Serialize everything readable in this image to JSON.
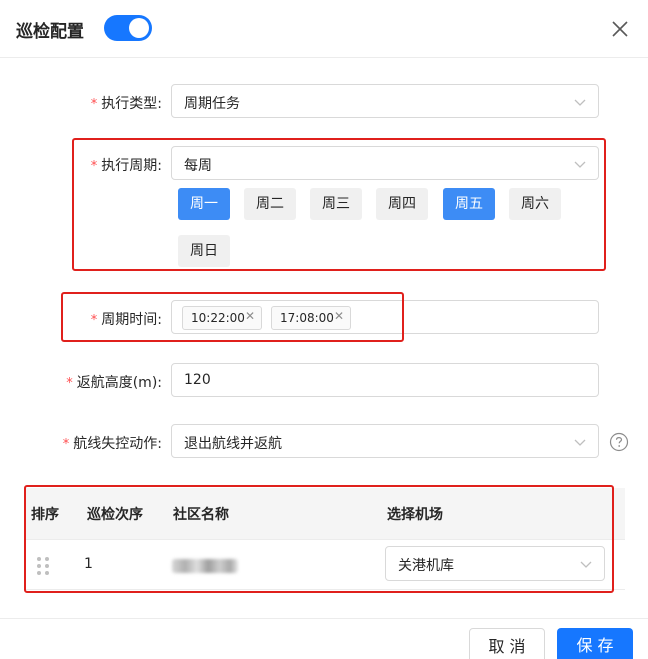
{
  "header": {
    "title": "巡检配置",
    "toggle_on": true
  },
  "form": {
    "type": {
      "label": "执行类型:",
      "value": "周期任务"
    },
    "cycle": {
      "label": "执行周期:",
      "value": "每周",
      "days": [
        {
          "label": "周一",
          "selected": true
        },
        {
          "label": "周二",
          "selected": false
        },
        {
          "label": "周三",
          "selected": false
        },
        {
          "label": "周四",
          "selected": false
        },
        {
          "label": "周五",
          "selected": true
        },
        {
          "label": "周六",
          "selected": false
        },
        {
          "label": "周日",
          "selected": false
        }
      ]
    },
    "time": {
      "label": "周期时间:",
      "tags": [
        "10:22:00",
        "17:08:00"
      ]
    },
    "height": {
      "label": "返航高度(m):",
      "value": "120"
    },
    "lost_action": {
      "label": "航线失控动作:",
      "value": "退出航线并返航"
    }
  },
  "table": {
    "headers": [
      "排序",
      "巡检次序",
      "社区名称",
      "选择机场"
    ],
    "rows": [
      {
        "order": "1",
        "airport": "关港机库"
      }
    ]
  },
  "footer": {
    "cancel": "取 消",
    "save": "保 存"
  },
  "colors": {
    "primary": "#1677ff",
    "selected_day": "#3d8cf5",
    "required": "#ff4d4f",
    "highlight_box": "#e0201c"
  }
}
